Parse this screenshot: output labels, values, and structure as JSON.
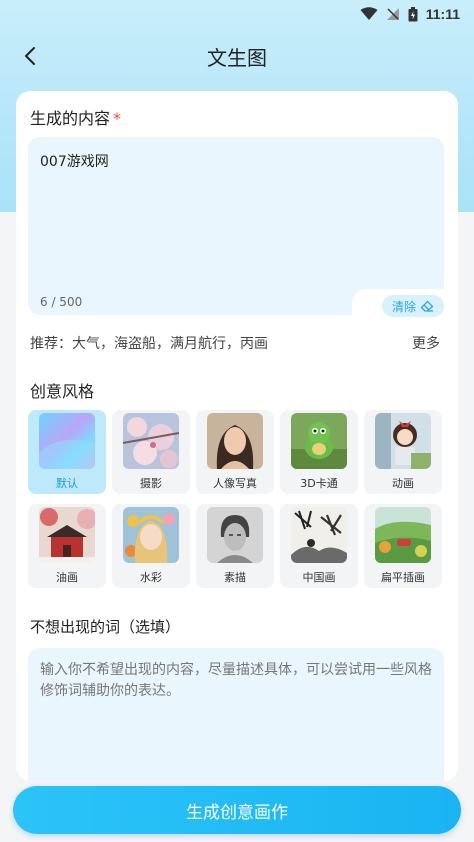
{
  "status_bar": {
    "time": "11:11"
  },
  "header": {
    "title": "文生图"
  },
  "prompt": {
    "label": "生成的内容",
    "required_mark": "*",
    "value": "007游戏网",
    "counter": "6 / 500",
    "clear_label": "清除"
  },
  "recommend": {
    "text": "推荐：大气，海盗船，满月航行，丙画",
    "more_label": "更多"
  },
  "styles": {
    "label": "创意风格",
    "items": [
      {
        "label": "默认",
        "selected": true
      },
      {
        "label": "摄影"
      },
      {
        "label": "人像写真"
      },
      {
        "label": "3D卡通"
      },
      {
        "label": "动画"
      },
      {
        "label": "油画"
      },
      {
        "label": "水彩"
      },
      {
        "label": "素描"
      },
      {
        "label": "中国画"
      },
      {
        "label": "扁平插画"
      }
    ]
  },
  "negative": {
    "label": "不想出现的词（选填）",
    "placeholder": "输入你不希望出现的内容，尽量描述具体，可以尝试用一些风格修饰词辅助你的表达。"
  },
  "generate": {
    "label": "生成创意画作"
  },
  "colors": {
    "accent": "#1fb8f4",
    "required": "#ef4a4a",
    "selected_bg": "#bde9fb"
  }
}
